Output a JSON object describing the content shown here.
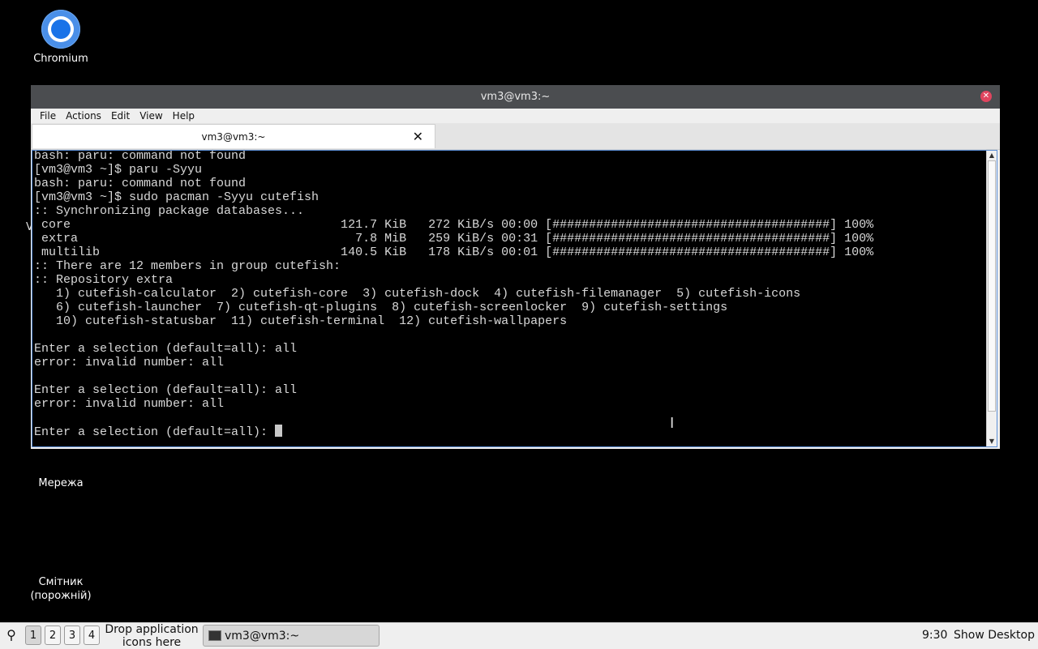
{
  "desktop": {
    "icons": [
      {
        "label": "Chromium",
        "icon": "chromium-icon"
      },
      {
        "label": "Мережа",
        "icon": "network-icon"
      },
      {
        "label": "Смітник\n(порожній)",
        "icon": "trash-icon"
      }
    ],
    "partial_label": "V"
  },
  "window": {
    "title": "vm3@vm3:~",
    "menu": [
      "File",
      "Actions",
      "Edit",
      "View",
      "Help"
    ],
    "tab": {
      "label": "vm3@vm3:~",
      "close_glyph": "✕"
    },
    "terminal": {
      "lines": [
        "bash: paru: command not found",
        "[vm3@vm3 ~]$ paru -Syyu",
        "bash: paru: command not found",
        "[vm3@vm3 ~]$ sudo pacman -Syyu cutefish",
        ":: Synchronizing package databases...",
        " core                                     121.7 KiB   272 KiB/s 00:00 [######################################] 100%",
        " extra                                      7.8 MiB   259 KiB/s 00:31 [######################################] 100%",
        " multilib                                 140.5 KiB   178 KiB/s 00:01 [######################################] 100%",
        ":: There are 12 members in group cutefish:",
        ":: Repository extra",
        "   1) cutefish-calculator  2) cutefish-core  3) cutefish-dock  4) cutefish-filemanager  5) cutefish-icons",
        "   6) cutefish-launcher  7) cutefish-qt-plugins  8) cutefish-screenlocker  9) cutefish-settings",
        "   10) cutefish-statusbar  11) cutefish-terminal  12) cutefish-wallpapers",
        "",
        "Enter a selection (default=all): all",
        "error: invalid number: all",
        "",
        "Enter a selection (default=all): all",
        "error: invalid number: all",
        "",
        "Enter a selection (default=all): "
      ]
    }
  },
  "taskbar": {
    "workspaces": [
      "1",
      "2",
      "3",
      "4"
    ],
    "drop_hint": "Drop application\nicons here",
    "task_label": "vm3@vm3:~",
    "clock": "9:30",
    "show_desktop": "Show Desktop"
  },
  "colors": {
    "titlebar": "#4b4d50",
    "close": "#e0455f",
    "terminal_bg": "#000000",
    "terminal_fg": "#d8d8d8",
    "focus_border": "#5b8ed6"
  }
}
